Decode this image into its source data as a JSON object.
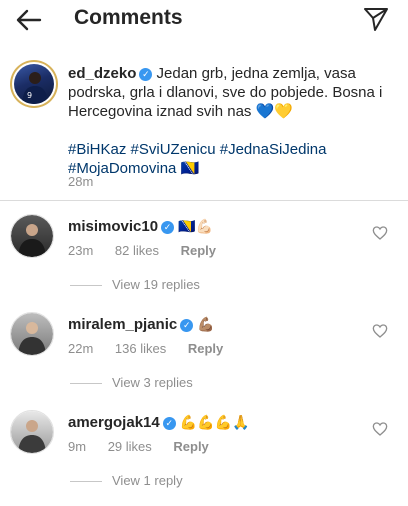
{
  "header": {
    "title": "Comments"
  },
  "caption": {
    "username": "ed_dzeko",
    "text": "Jedan grb, jedna zemlja, vasa podrska, grla i dlanovi, sve do pobjede. Bosna i Hercegovina iznad svih nas 💙💛",
    "hashtags": "#BiHKaz #SviUZenicu #JednaSiJedina #MojaDomovina 🇧🇦",
    "time": "28m"
  },
  "comments": [
    {
      "username": "misimovic10",
      "text": "🇧🇦💪🏻",
      "time": "23m",
      "likes": "82 likes",
      "reply": "Reply",
      "view_replies": "View 19 replies"
    },
    {
      "username": "miralem_pjanic",
      "text": "💪🏽",
      "time": "22m",
      "likes": "136 likes",
      "reply": "Reply",
      "view_replies": "View 3 replies"
    },
    {
      "username": "amergojak14",
      "text": "💪💪💪🙏",
      "time": "9m",
      "likes": "29 likes",
      "reply": "Reply",
      "view_replies": "View 1 reply"
    }
  ],
  "icons": {
    "back": "arrow-left-icon",
    "send": "paper-plane-icon",
    "verified": "verified-badge-icon",
    "like": "heart-outline-icon"
  },
  "colors": {
    "text": "#262626",
    "muted": "#8e8e8e",
    "hashtag": "#00376b",
    "verified": "#3897f0",
    "divider": "#dbdbdb"
  }
}
